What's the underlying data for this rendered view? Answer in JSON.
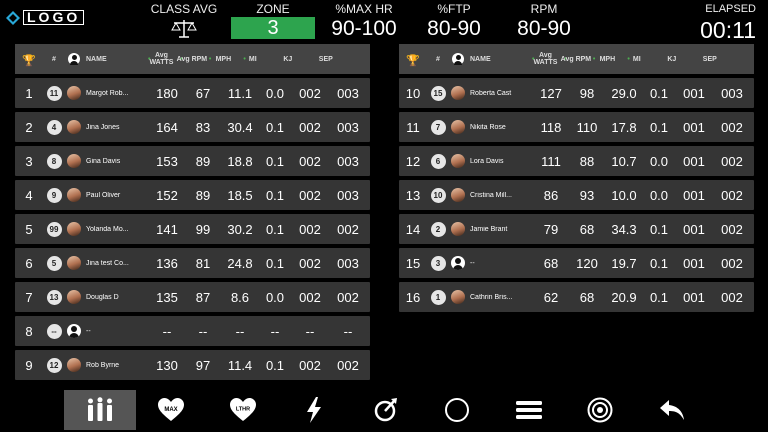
{
  "logo": {
    "text": "LOGO"
  },
  "header": {
    "class_avg": {
      "label": "CLASS AVG",
      "icon": "scale-icon"
    },
    "zone": {
      "label": "ZONE",
      "value": "3",
      "color": "#2da44e"
    },
    "max_hr": {
      "label": "%MAX HR",
      "value": "90-100"
    },
    "ftp": {
      "label": "%FTP",
      "value": "80-90"
    },
    "rpm": {
      "label": "RPM",
      "value": "80-90"
    },
    "elapsed": {
      "label": "ELAPSED",
      "value": "00:11"
    }
  },
  "columns": {
    "num": "#",
    "name": "NAME",
    "watts": "Avg WATTS",
    "rpm": "Avg RPM",
    "mph": "MPH",
    "mi": "MI",
    "kj": "KJ",
    "sep": "SEP"
  },
  "left_rows": [
    {
      "rank": "1",
      "bib": "11",
      "name": "Margot Rob...",
      "watts": "180",
      "rpm": "67",
      "mph": "11.1",
      "mi": "0.0",
      "kj": "002",
      "sep": "003"
    },
    {
      "rank": "2",
      "bib": "4",
      "name": "Jina Jones",
      "watts": "164",
      "rpm": "83",
      "mph": "30.4",
      "mi": "0.1",
      "kj": "002",
      "sep": "003"
    },
    {
      "rank": "3",
      "bib": "8",
      "name": "Gina Davis",
      "watts": "153",
      "rpm": "89",
      "mph": "18.8",
      "mi": "0.1",
      "kj": "002",
      "sep": "003"
    },
    {
      "rank": "4",
      "bib": "9",
      "name": "Paul Oliver",
      "watts": "152",
      "rpm": "89",
      "mph": "18.5",
      "mi": "0.1",
      "kj": "002",
      "sep": "003"
    },
    {
      "rank": "5",
      "bib": "99",
      "name": "Yolanda Mo...",
      "watts": "141",
      "rpm": "99",
      "mph": "30.2",
      "mi": "0.1",
      "kj": "002",
      "sep": "002"
    },
    {
      "rank": "6",
      "bib": "5",
      "name": "Jina test Co...",
      "watts": "136",
      "rpm": "81",
      "mph": "24.8",
      "mi": "0.1",
      "kj": "002",
      "sep": "003"
    },
    {
      "rank": "7",
      "bib": "13",
      "name": "Douglas D",
      "watts": "135",
      "rpm": "87",
      "mph": "8.6",
      "mi": "0.0",
      "kj": "002",
      "sep": "002"
    },
    {
      "rank": "8",
      "bib": "--",
      "name": "--",
      "watts": "--",
      "rpm": "--",
      "mph": "--",
      "mi": "--",
      "kj": "--",
      "sep": "--"
    },
    {
      "rank": "9",
      "bib": "12",
      "name": "Rob Byrne",
      "watts": "130",
      "rpm": "97",
      "mph": "11.4",
      "mi": "0.1",
      "kj": "002",
      "sep": "002"
    }
  ],
  "right_rows": [
    {
      "rank": "10",
      "bib": "15",
      "name": "Roberta Cast",
      "watts": "127",
      "rpm": "98",
      "mph": "29.0",
      "mi": "0.1",
      "kj": "001",
      "sep": "003"
    },
    {
      "rank": "11",
      "bib": "7",
      "name": "Nikita Rose",
      "watts": "118",
      "rpm": "110",
      "mph": "17.8",
      "mi": "0.1",
      "kj": "001",
      "sep": "002"
    },
    {
      "rank": "12",
      "bib": "6",
      "name": "Lora Davis",
      "watts": "111",
      "rpm": "88",
      "mph": "10.7",
      "mi": "0.0",
      "kj": "001",
      "sep": "002"
    },
    {
      "rank": "13",
      "bib": "10",
      "name": "Cristina Mill...",
      "watts": "86",
      "rpm": "93",
      "mph": "10.0",
      "mi": "0.0",
      "kj": "001",
      "sep": "002"
    },
    {
      "rank": "14",
      "bib": "2",
      "name": "Jamie Brant",
      "watts": "79",
      "rpm": "68",
      "mph": "34.3",
      "mi": "0.1",
      "kj": "001",
      "sep": "002"
    },
    {
      "rank": "15",
      "bib": "3",
      "name": "--",
      "watts": "68",
      "rpm": "120",
      "mph": "19.7",
      "mi": "0.1",
      "kj": "001",
      "sep": "002"
    },
    {
      "rank": "16",
      "bib": "1",
      "name": "Cathrin Bris...",
      "watts": "62",
      "rpm": "68",
      "mph": "20.9",
      "mi": "0.1",
      "kj": "001",
      "sep": "002"
    }
  ],
  "toolbar": {
    "items": [
      {
        "icon": "group-icon",
        "active": true
      },
      {
        "icon": "heart-max-icon",
        "label": "MAX"
      },
      {
        "icon": "heart-lthr-icon",
        "label": "LTHR"
      },
      {
        "icon": "lightning-icon"
      },
      {
        "icon": "cadence-icon"
      },
      {
        "icon": "circle-icon"
      },
      {
        "icon": "menu-icon"
      },
      {
        "icon": "target-icon"
      },
      {
        "icon": "back-arrow-icon"
      }
    ]
  }
}
